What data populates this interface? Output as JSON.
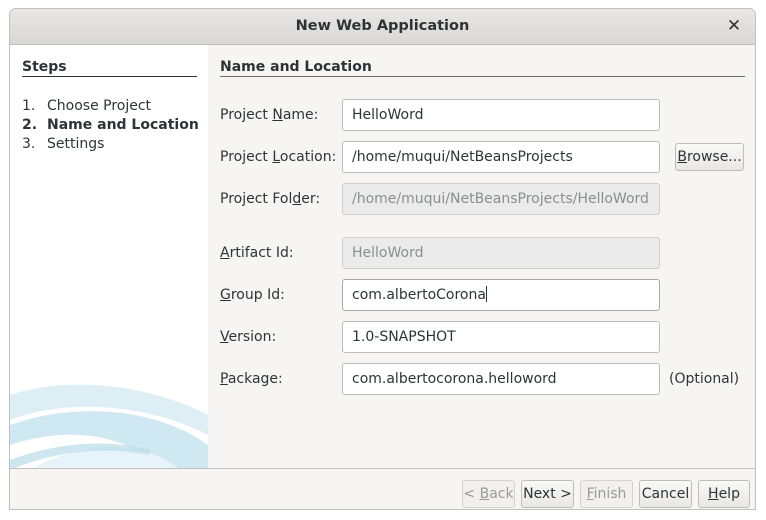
{
  "window": {
    "title": "New Web Application",
    "close_glyph": "✕"
  },
  "steps": {
    "heading": "Steps",
    "items": [
      {
        "num": "1.",
        "label": "Choose Project"
      },
      {
        "num": "2.",
        "label": "Name and Location"
      },
      {
        "num": "3.",
        "label": "Settings"
      }
    ],
    "active_index": 1
  },
  "section": {
    "title": "Name and Location"
  },
  "fields": {
    "project_name": {
      "label_pre": "Project ",
      "label_mn": "N",
      "label_post": "ame:",
      "value": "HelloWord"
    },
    "project_location": {
      "label_pre": "Project ",
      "label_mn": "L",
      "label_post": "ocation:",
      "value": "/home/muqui/NetBeansProjects"
    },
    "project_folder": {
      "label_pre": "Project Fol",
      "label_mn": "d",
      "label_post": "er:",
      "value": "/home/muqui/NetBeansProjects/HelloWord"
    },
    "artifact_id": {
      "label_pre": "",
      "label_mn": "A",
      "label_post": "rtifact Id:",
      "value": "HelloWord"
    },
    "group_id": {
      "label_pre": "",
      "label_mn": "G",
      "label_post": "roup Id:",
      "value": "com.albertoCorona"
    },
    "version": {
      "label_pre": "",
      "label_mn": "V",
      "label_post": "ersion:",
      "value": "1.0-SNAPSHOT"
    },
    "package": {
      "label_pre": "",
      "label_mn": "P",
      "label_post": "ackage:",
      "value": "com.albertocorona.helloword",
      "suffix": "(Optional)"
    }
  },
  "buttons": {
    "browse": {
      "pre": "",
      "mn": "B",
      "post": "rowse..."
    },
    "back": {
      "pre": "< ",
      "mn": "B",
      "post": "ack"
    },
    "next": {
      "pre": "Next >",
      "mn": "",
      "post": ""
    },
    "finish": {
      "pre": "",
      "mn": "F",
      "post": "inish"
    },
    "cancel": {
      "pre": "Cancel",
      "mn": "",
      "post": ""
    },
    "help": {
      "pre": "",
      "mn": "H",
      "post": "elp"
    }
  },
  "colors": {
    "accent_swoosh": "#9fd0e3",
    "window_bg": "#f6f5f4",
    "panel_bg": "#ffffff"
  }
}
